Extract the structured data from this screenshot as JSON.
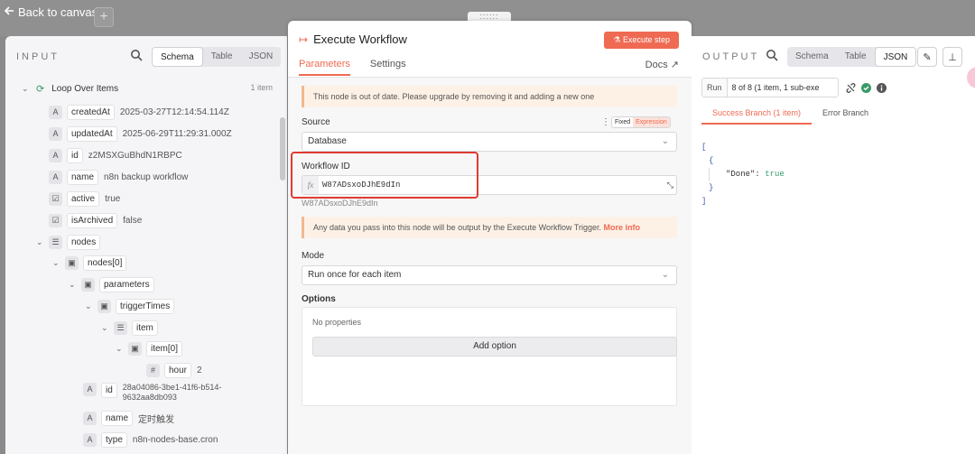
{
  "topbar": {
    "back_label": "Back to canvas",
    "add_label": "+",
    "drag_dots": "::::::"
  },
  "input": {
    "title": "INPUT",
    "views": [
      "Schema",
      "Table",
      "JSON"
    ],
    "root": {
      "label": "Loop Over Items",
      "count": "1 item"
    },
    "fields": [
      {
        "type": "A",
        "key": "createdAt",
        "value": "2025-03-27T12:14:54.114Z"
      },
      {
        "type": "A",
        "key": "updatedAt",
        "value": "2025-06-29T11:29:31.000Z"
      },
      {
        "type": "A",
        "key": "id",
        "value": "z2MSXGuBhdN1RBPC"
      },
      {
        "type": "A",
        "key": "name",
        "value": "n8n backup workflow"
      },
      {
        "type": "☑",
        "key": "active",
        "value": "true"
      },
      {
        "type": "☑",
        "key": "isArchived",
        "value": "false"
      }
    ],
    "nodes_label": "nodes",
    "nodes0_label": "nodes[0]",
    "parameters_label": "parameters",
    "triggerTimes_label": "triggerTimes",
    "item_label": "item",
    "item0_label": "item[0]",
    "hour": {
      "type": "#",
      "key": "hour",
      "value": "2"
    },
    "node_id": {
      "type": "A",
      "key": "id",
      "value": "28a04086-3be1-41f6-b514-9632aa8db093"
    },
    "node_name": {
      "type": "A",
      "key": "name",
      "value": "定时触发"
    },
    "node_type": {
      "type": "A",
      "key": "type",
      "value": "n8n-nodes-base.cron"
    }
  },
  "node": {
    "title": "Execute Workflow",
    "execute_label": "Execute step",
    "tabs": [
      "Parameters",
      "Settings"
    ],
    "docs_label": "Docs",
    "outdated_notice": "This node is out of date. Please upgrade by removing it and adding a new one",
    "source_label": "Source",
    "mode_fixed": "Fixed",
    "mode_expression": "Expression",
    "source_value": "Database",
    "workflow_id_label": "Workflow ID",
    "workflow_id_value": "W87ADsxoDJhE9dIn",
    "workflow_id_resolved": "W87ADsxoDJhE9dIn",
    "data_notice": "Any data you pass into this node will be output by the Execute Workflow Trigger.",
    "more_info": "More info",
    "mode_label": "Mode",
    "mode_value": "Run once for each item",
    "options_label": "Options",
    "no_properties": "No properties",
    "add_option": "Add option"
  },
  "output": {
    "title": "OUTPUT",
    "views": [
      "Schema",
      "Table",
      "JSON"
    ],
    "run_label": "Run",
    "run_value": "8 of 8 (1 item, 1 sub-exe",
    "branches": [
      "Success Branch (1 item)",
      "Error Branch"
    ],
    "json_key": "\"Done\"",
    "json_value": "true"
  },
  "colors": {
    "accent": "#ef6a52",
    "success": "#3a9a6a",
    "alert": "#e03a32"
  }
}
